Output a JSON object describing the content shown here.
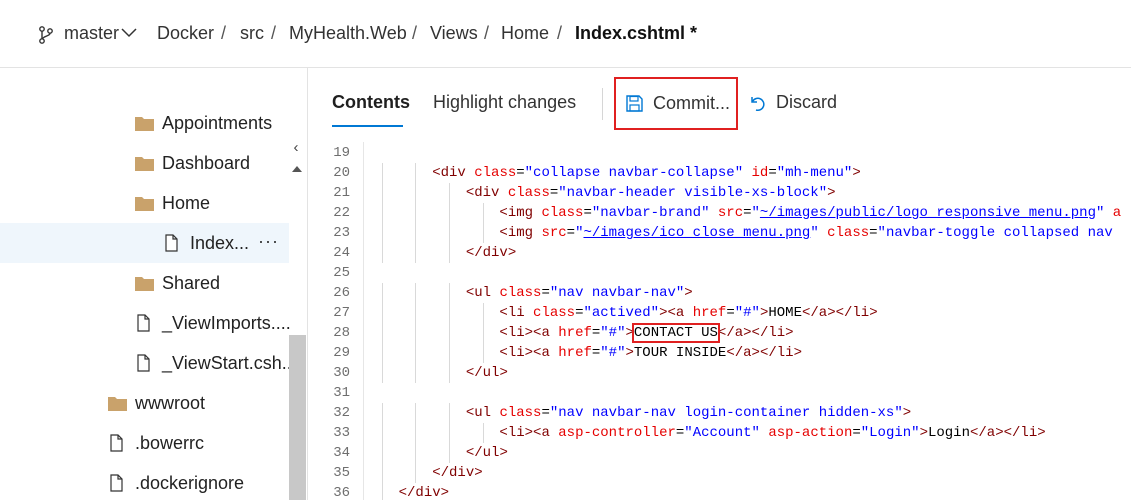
{
  "breadcrumb": {
    "branch": "master",
    "path": [
      "Docker",
      "src",
      "MyHealth.Web",
      "Views",
      "Home"
    ],
    "current": "Index.cshtml *",
    "separator": "/"
  },
  "sidebar": {
    "collapse_glyph": "‹",
    "items": [
      {
        "type": "folder",
        "label": "Appointments"
      },
      {
        "type": "folder",
        "label": "Dashboard"
      },
      {
        "type": "folder",
        "label": "Home"
      },
      {
        "type": "file",
        "label": "Index...",
        "selected": true,
        "more": "···"
      },
      {
        "type": "folder",
        "label": "Shared"
      },
      {
        "type": "file",
        "label": "_ViewImports...."
      },
      {
        "type": "file",
        "label": "_ViewStart.csh..."
      },
      {
        "type": "folder",
        "label": "wwwroot"
      },
      {
        "type": "file",
        "label": ".bowerrc"
      },
      {
        "type": "file",
        "label": ".dockerignore"
      }
    ]
  },
  "toolbar": {
    "tabs": [
      {
        "label": "Contents",
        "active": true
      },
      {
        "label": "Highlight changes",
        "active": false
      }
    ],
    "commit_label": "Commit...",
    "discard_label": "Discard"
  },
  "editor": {
    "lines": [
      {
        "n": "19",
        "code": ""
      },
      {
        "n": "20",
        "code": "        <div class=\"collapse navbar-collapse\" id=\"mh-menu\">"
      },
      {
        "n": "21",
        "code": "            <div class=\"navbar-header visible-xs-block\">"
      },
      {
        "n": "22",
        "code": "                <img class=\"navbar-brand\" src=\"~/images/public/logo_responsive_menu.png\" a"
      },
      {
        "n": "23",
        "code": "                <img src=\"~/images/ico_close_menu.png\" class=\"navbar-toggle collapsed nav"
      },
      {
        "n": "24",
        "code": "            </div>"
      },
      {
        "n": "25",
        "code": ""
      },
      {
        "n": "26",
        "code": "            <ul class=\"nav navbar-nav\">"
      },
      {
        "n": "27",
        "code": "                <li class=\"actived\"><a href=\"#\">HOME</a></li>"
      },
      {
        "n": "28",
        "code": "                <li><a href=\"#\">CONTACT US</a></li>"
      },
      {
        "n": "29",
        "code": "                <li><a href=\"#\">TOUR INSIDE</a></li>"
      },
      {
        "n": "30",
        "code": "            </ul>"
      },
      {
        "n": "31",
        "code": ""
      },
      {
        "n": "32",
        "code": "            <ul class=\"nav navbar-nav login-container hidden-xs\">"
      },
      {
        "n": "33",
        "code": "                <li><a asp-controller=\"Account\" asp-action=\"Login\">Login</a></li>"
      },
      {
        "n": "34",
        "code": "            </ul>"
      },
      {
        "n": "35",
        "code": "        </div>"
      },
      {
        "n": "36",
        "code": "    </div>"
      }
    ],
    "highlighted_text": "CONTACT US"
  },
  "colors": {
    "accent": "#0078d4",
    "highlight_box": "#e02020",
    "tag": "#800000",
    "attr": "#e50000",
    "value": "#0000ff",
    "folder": "#c9a26b"
  }
}
